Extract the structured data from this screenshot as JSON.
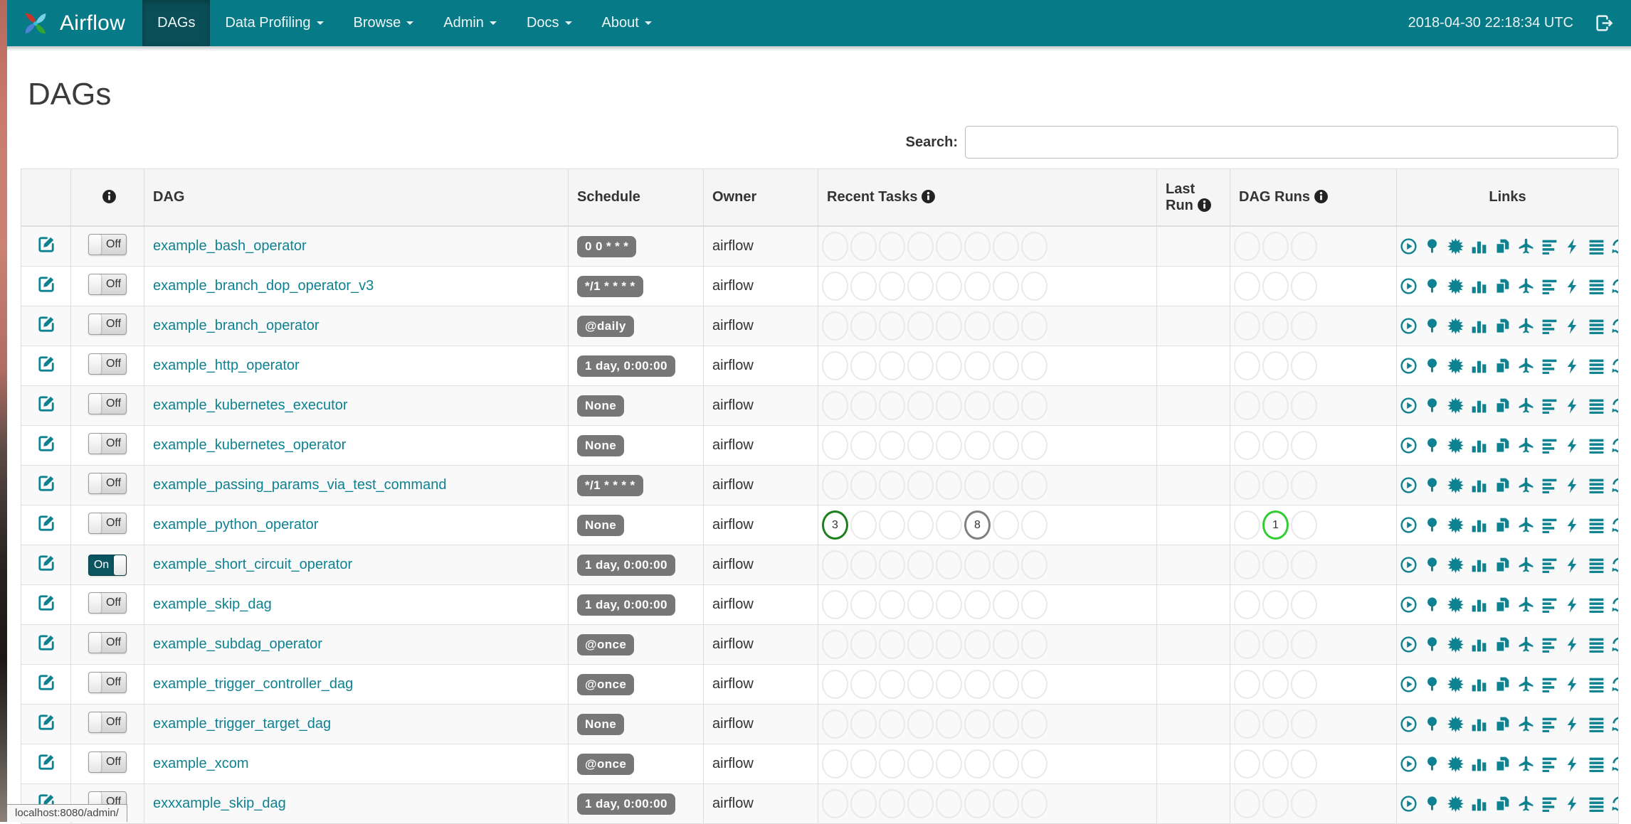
{
  "navbar": {
    "brand": "Airflow",
    "items": [
      {
        "label": "DAGs",
        "active": true,
        "caret": false
      },
      {
        "label": "Data Profiling",
        "active": false,
        "caret": true
      },
      {
        "label": "Browse",
        "active": false,
        "caret": true
      },
      {
        "label": "Admin",
        "active": false,
        "caret": true
      },
      {
        "label": "Docs",
        "active": false,
        "caret": true
      },
      {
        "label": "About",
        "active": false,
        "caret": true
      }
    ],
    "clock": "2018-04-30 22:18:34 UTC"
  },
  "page": {
    "title": "DAGs",
    "search_label": "Search:",
    "search_value": "",
    "status_url": "localhost:8080/admin/"
  },
  "table": {
    "headers": {
      "dag": "DAG",
      "schedule": "Schedule",
      "owner": "Owner",
      "recent_tasks": "Recent Tasks",
      "last_run": "Last Run",
      "dag_runs": "DAG Runs",
      "links": "Links"
    },
    "toggle": {
      "on": "On",
      "off": "Off"
    },
    "recent_task_slots": 8,
    "dag_run_slots": 3,
    "colors": {
      "navbar": "#077A87",
      "accent": "#0E8290",
      "badge": "#777777",
      "state_success": "#1B7F1B",
      "state_queued": "#808080",
      "state_running": "#32CD32",
      "circle_empty": "#E9E9E9"
    },
    "links_icons": [
      "trigger-dag",
      "tree-view",
      "graph-view",
      "task-duration",
      "task-tries",
      "landing-times",
      "gantt-view",
      "code-view",
      "logs",
      "refresh"
    ],
    "rows": [
      {
        "name": "example_bash_operator",
        "schedule": "0 0 * * *",
        "owner": "airflow",
        "enabled": false,
        "recent_tasks": [],
        "dag_runs": []
      },
      {
        "name": "example_branch_dop_operator_v3",
        "schedule": "*/1 * * * *",
        "owner": "airflow",
        "enabled": false,
        "recent_tasks": [],
        "dag_runs": []
      },
      {
        "name": "example_branch_operator",
        "schedule": "@daily",
        "owner": "airflow",
        "enabled": false,
        "recent_tasks": [],
        "dag_runs": []
      },
      {
        "name": "example_http_operator",
        "schedule": "1 day, 0:00:00",
        "owner": "airflow",
        "enabled": false,
        "recent_tasks": [],
        "dag_runs": []
      },
      {
        "name": "example_kubernetes_executor",
        "schedule": "None",
        "owner": "airflow",
        "enabled": false,
        "recent_tasks": [],
        "dag_runs": []
      },
      {
        "name": "example_kubernetes_operator",
        "schedule": "None",
        "owner": "airflow",
        "enabled": false,
        "recent_tasks": [],
        "dag_runs": []
      },
      {
        "name": "example_passing_params_via_test_command",
        "schedule": "*/1 * * * *",
        "owner": "airflow",
        "enabled": false,
        "recent_tasks": [],
        "dag_runs": []
      },
      {
        "name": "example_python_operator",
        "schedule": "None",
        "owner": "airflow",
        "enabled": false,
        "recent_tasks": [
          {
            "slot": 0,
            "count": "3",
            "state": "success"
          },
          {
            "slot": 5,
            "count": "8",
            "state": "queued"
          }
        ],
        "dag_runs": [
          {
            "slot": 1,
            "count": "1",
            "state": "running"
          }
        ]
      },
      {
        "name": "example_short_circuit_operator",
        "schedule": "1 day, 0:00:00",
        "owner": "airflow",
        "enabled": true,
        "recent_tasks": [],
        "dag_runs": []
      },
      {
        "name": "example_skip_dag",
        "schedule": "1 day, 0:00:00",
        "owner": "airflow",
        "enabled": false,
        "recent_tasks": [],
        "dag_runs": []
      },
      {
        "name": "example_subdag_operator",
        "schedule": "@once",
        "owner": "airflow",
        "enabled": false,
        "recent_tasks": [],
        "dag_runs": []
      },
      {
        "name": "example_trigger_controller_dag",
        "schedule": "@once",
        "owner": "airflow",
        "enabled": false,
        "recent_tasks": [],
        "dag_runs": []
      },
      {
        "name": "example_trigger_target_dag",
        "schedule": "None",
        "owner": "airflow",
        "enabled": false,
        "recent_tasks": [],
        "dag_runs": []
      },
      {
        "name": "example_xcom",
        "schedule": "@once",
        "owner": "airflow",
        "enabled": false,
        "recent_tasks": [],
        "dag_runs": []
      },
      {
        "name": "exxxample_skip_dag",
        "schedule": "1 day, 0:00:00",
        "owner": "airflow",
        "enabled": false,
        "recent_tasks": [],
        "dag_runs": []
      }
    ]
  }
}
